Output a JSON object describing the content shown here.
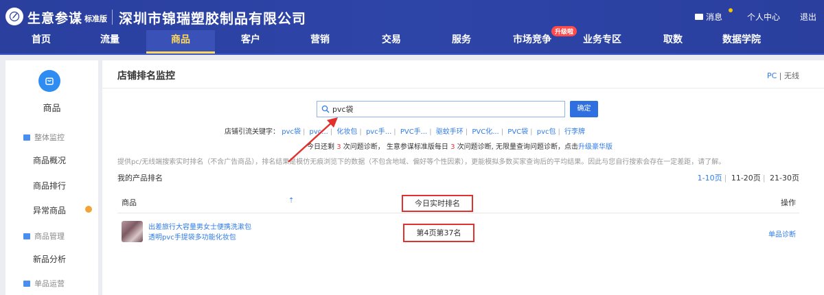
{
  "header": {
    "brand": "生意参谋",
    "edition": "标准版",
    "company": "深圳市锦瑞塑胶制品有限公司",
    "messages": "消息",
    "user_center": "个人中心",
    "logout": "退出",
    "badge": "升级啦"
  },
  "nav": [
    "首页",
    "流量",
    "商品",
    "客户",
    "营销",
    "交易",
    "服务",
    "市场竞争",
    "业务专区",
    "取数",
    "数据学院"
  ],
  "sidebar": {
    "title": "商品",
    "group1": "整体监控",
    "item1": "商品概况",
    "item2": "商品排行",
    "item3": "异常商品",
    "group2": "商品管理",
    "item4": "新品分析",
    "group3": "单品运营"
  },
  "main": {
    "title": "店铺排名监控",
    "device_pc": "PC",
    "device_sep": "|",
    "device_wireless": "无线",
    "search_value": "pvc袋",
    "ok_button": "确定",
    "kw_label": "店铺引流关键字：",
    "keywords": [
      "pvc袋",
      "pvc...",
      "化妆包",
      "pvc手...",
      "PVC手...",
      "驱蚊手环",
      "PVC化...",
      "PVC袋",
      "pvc包",
      "行李牌"
    ],
    "info_prefix": "今日还剩",
    "info_count1": "3",
    "info_mid": "次问题诊断， 生意参谋标准版每日",
    "info_count2": "3",
    "info_suffix": "次问题诊断, 无限量查询问题诊断，点击",
    "info_link": "升级豪华版",
    "desc": "提供pc/无线端搜索实时排名（不含广告商品），排名结果是模仿无痕浏览下的数据（不包含地域、偏好等个性因素），更能模拟多数买家查询后的平均结果。因此与您自行搜索会存在一定差距，请了解。",
    "rank_title": "我的产品排名",
    "pages": [
      "1-10页",
      "11-20页",
      "21-30页"
    ],
    "col_product": "商品",
    "col_rank": "今日实时排名",
    "col_action": "操作",
    "sort_mark": "⇡",
    "product_name": "出差旅行大容量男女士便携洗漱包 透明pvc手提袋多功能化妆包",
    "rank_value": "第4页第37名",
    "action": "单品诊断"
  }
}
